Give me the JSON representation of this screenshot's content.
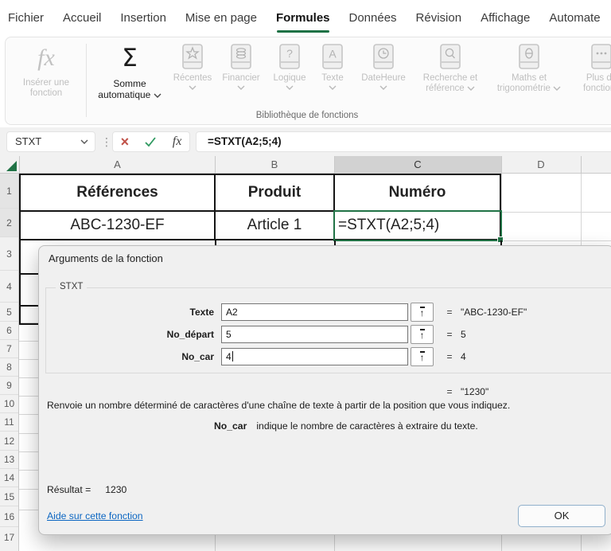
{
  "menu": {
    "tabs": [
      "Fichier",
      "Accueil",
      "Insertion",
      "Mise en page",
      "Formules",
      "Données",
      "Révision",
      "Affichage",
      "Automate"
    ],
    "active_tab": "Formules"
  },
  "ribbon": {
    "insert_function_label": "Insérer une fonction",
    "autosum_label": "Somme automatique",
    "library": [
      {
        "label": "Récentes"
      },
      {
        "label": "Financier"
      },
      {
        "label": "Logique"
      },
      {
        "label": "Texte"
      },
      {
        "label": "DateHeure"
      },
      {
        "label": "Recherche et référence"
      },
      {
        "label": "Maths et trigonométrie"
      },
      {
        "label": "Plus de fonctions"
      }
    ],
    "group_label": "Bibliothèque de fonctions"
  },
  "icons": {
    "fx": "fx",
    "sigma": "Σ",
    "dots": "⋮",
    "cancel": "×",
    "up_arrow": "↑"
  },
  "formula_bar": {
    "name_box": "STXT",
    "formula": "=STXT(A2;5;4)"
  },
  "grid": {
    "columns": [
      "A",
      "B",
      "C",
      "D"
    ],
    "selected_column": "C",
    "rows": [
      "1",
      "2",
      "3",
      "4",
      "5",
      "6",
      "7",
      "8",
      "9",
      "10",
      "11",
      "12",
      "13",
      "14",
      "15",
      "16",
      "17"
    ],
    "cells": {
      "a1": "Références",
      "b1": "Produit",
      "c1": "Numéro",
      "a2": "ABC-1230-EF",
      "b2": "Article 1",
      "c2": "=STXT(A2;5;4)"
    }
  },
  "dialog": {
    "title": "Arguments de la fonction",
    "function_name": "STXT",
    "equals": "=",
    "args": [
      {
        "label": "Texte",
        "value": "A2",
        "result": "\"ABC-1230-EF\""
      },
      {
        "label": "No_départ",
        "value": "5",
        "result": "5"
      },
      {
        "label": "No_car",
        "value": "4",
        "result": "4"
      }
    ],
    "intermediate_result": "\"1230\"",
    "description": "Renvoie un nombre déterminé de caractères d'une chaîne de texte à partir de la position que vous indiquez.",
    "help_arg": "No_car",
    "help_text": "indique le nombre de caractères à extraire du texte.",
    "result_label": "Résultat =",
    "result_value": "1230",
    "help_link": "Aide sur cette fonction",
    "ok": "OK"
  },
  "colors": {
    "excel_green": "#217346",
    "link_blue": "#0c66c2",
    "cancel_red": "#c05148",
    "check_green": "#2f9960"
  }
}
